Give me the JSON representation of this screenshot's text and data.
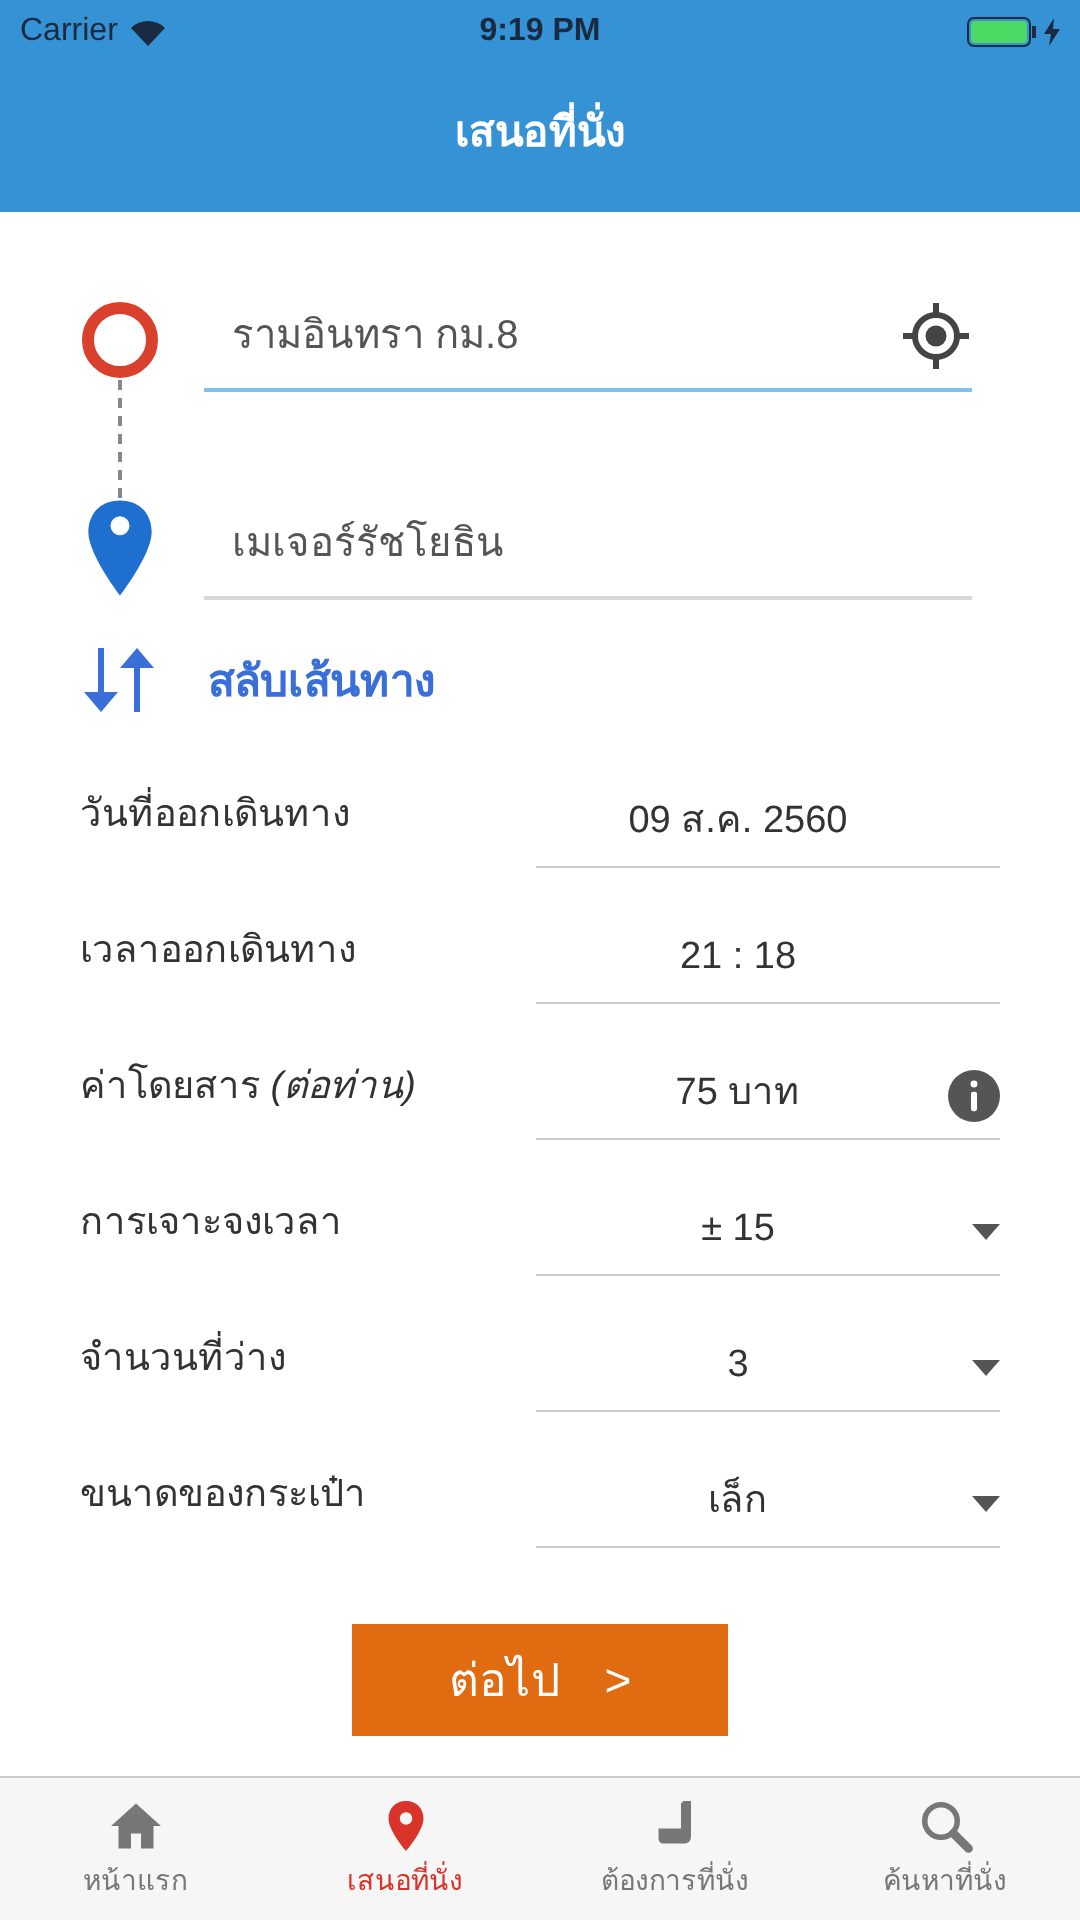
{
  "status_bar": {
    "carrier": "Carrier",
    "time": "9:19 PM"
  },
  "nav": {
    "title": "เสนอที่นั่ง"
  },
  "route": {
    "origin": {
      "value": "รามอินทรา กม.8",
      "focused": true
    },
    "destination": {
      "value": "เมเจอร์รัชโยธิน",
      "focused": false
    },
    "swap_label": "สลับเส้นทาง"
  },
  "form": [
    {
      "kind": "value",
      "label": "วันที่ออกเดินทาง",
      "value": "09 ส.ค. 2560"
    },
    {
      "kind": "value",
      "label": "เวลาออกเดินทาง",
      "value": "21 : 18"
    },
    {
      "kind": "info",
      "label": "ค่าโดยสาร *(ต่อท่าน)*",
      "value": "75 บาท"
    },
    {
      "kind": "dropdown",
      "label": "การเจาะจงเวลา",
      "value": "± 15"
    },
    {
      "kind": "dropdown",
      "label": "จำนวนที่ว่าง",
      "value": "3"
    },
    {
      "kind": "dropdown",
      "label": "ขนาดของกระเป๋า",
      "value": "เล็ก"
    }
  ],
  "next_button": {
    "label": "ต่อไป",
    "arrow": ">"
  },
  "tab_bar": [
    {
      "label": "หน้าแรก",
      "kind": "home",
      "selected": false
    },
    {
      "label": "เสนอที่นั่ง",
      "kind": "pin",
      "selected": true
    },
    {
      "label": "ต้องการที่นั่ง",
      "kind": "seat",
      "selected": false
    },
    {
      "label": "ค้นหาที่นั่ง",
      "kind": "search",
      "selected": false
    }
  ]
}
